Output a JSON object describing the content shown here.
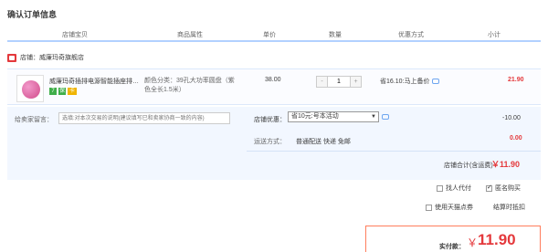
{
  "page_title": "确认订单信息",
  "columns": [
    "店铺宝贝",
    "商品属性",
    "单价",
    "数量",
    "优惠方式",
    "小计"
  ],
  "shop": {
    "prefix": "店铺：",
    "name": "威廉玛奇旗舰店"
  },
  "item": {
    "name": "威廉玛奇插排电源智能插座排插...",
    "spec": "颜色分类：39孔大功率圆盘（紫色全长1.5米）",
    "price": "38.00",
    "quantity": "1",
    "qty_minus": "-",
    "qty_plus": "+",
    "promotion": "省16.10:马上备价",
    "subtotal": "21.90",
    "badges": [
      "7",
      "保",
      "卡"
    ]
  },
  "extras": {
    "message_label": "给卖家留言：",
    "message_placeholder": "选填:对本次交易的说明(建议填写已和卖家协商一致的内容)",
    "coupon_label": "店铺优惠：",
    "coupon_selected": "省10元:号本活动",
    "discount": "-10.00",
    "shipping_label": "运送方式：",
    "shipping_value": "普通配送 快递 免邮",
    "shipping_fee": "0.00",
    "shop_total_label": "店铺合计(含运费)",
    "shop_total": "￥11.90"
  },
  "options": {
    "proxy_pay": "找人代付",
    "anonymous": "匿名购买",
    "tmall_points": "使用天猫点券",
    "points_note": "结算时抵扣"
  },
  "payment": {
    "label": "实付款：",
    "currency": "￥",
    "amount": "11.90"
  }
}
